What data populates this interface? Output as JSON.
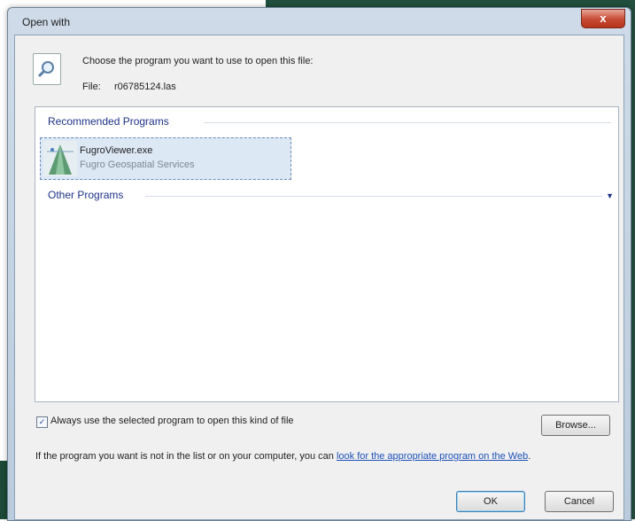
{
  "window": {
    "title": "Open with",
    "close_label": "x"
  },
  "header": {
    "prompt": "Choose the program you want to use to open this file:",
    "file_label": "File:",
    "file_name": "r06785124.las"
  },
  "program_list": {
    "recommended_header": "Recommended Programs",
    "other_header": "Other Programs",
    "expand_icon": "chevron-down-icon",
    "items": [
      {
        "name": "FugroViewer.exe",
        "publisher": "Fugro Geospatial Services"
      }
    ]
  },
  "options": {
    "always_use_label": "Always use the selected program to open this kind of file",
    "always_use_checked": true
  },
  "browse_button": {
    "label": "Browse..."
  },
  "info": {
    "text": "If the program you want is not in the list or on your computer, you can ",
    "link_text": "look for the appropriate program on the Web",
    "suffix": "."
  },
  "buttons": {
    "ok": "OK",
    "cancel": "Cancel"
  },
  "colors": {
    "link": "#1c4fb8",
    "group_header": "#1e3287",
    "selection": "#dde8f5",
    "close_button": "#c54a33"
  }
}
